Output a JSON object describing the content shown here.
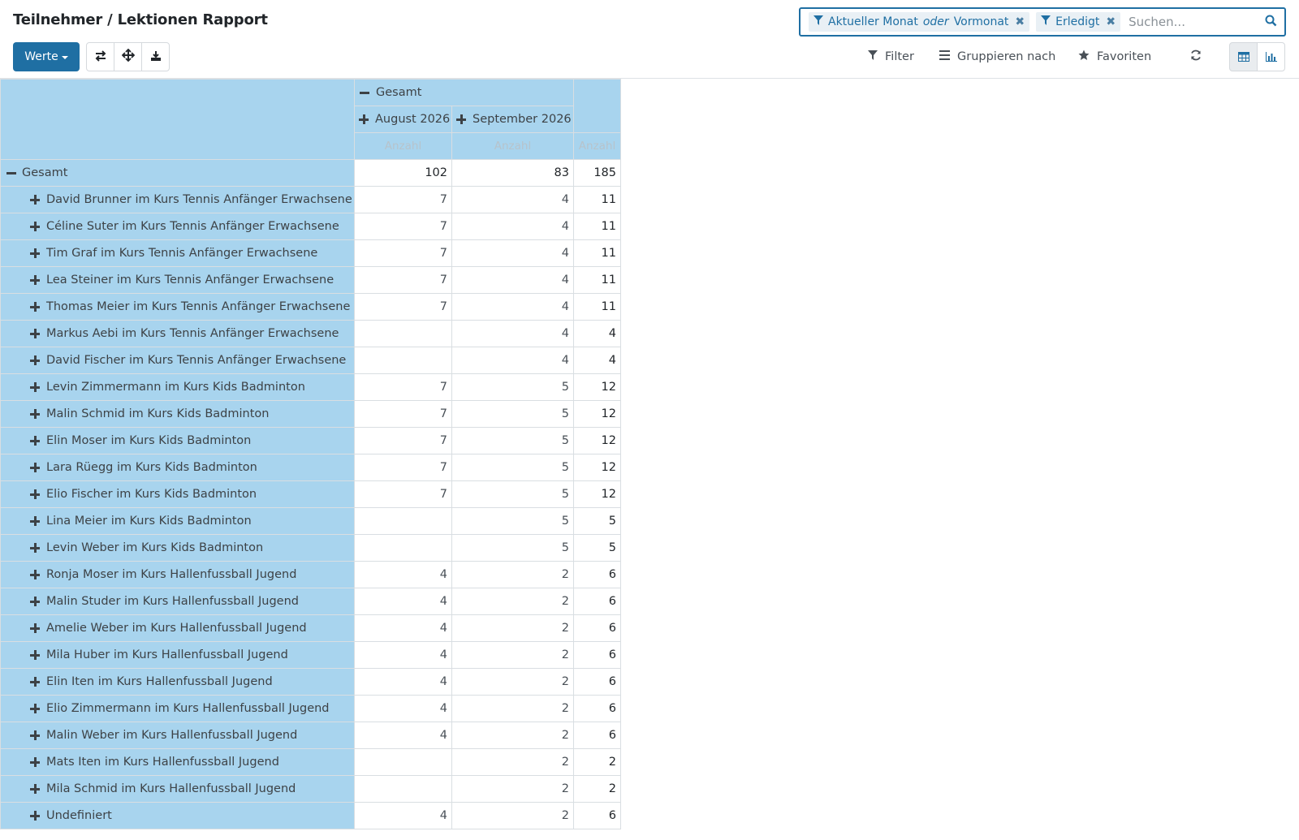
{
  "header": {
    "title": "Teilnehmer / Lektionen Rapport",
    "values_button": "Werte"
  },
  "search": {
    "facets": [
      {
        "part1": "Aktueller Monat",
        "or": "oder",
        "part2": "Vormonat"
      },
      {
        "label": "Erledigt"
      }
    ],
    "placeholder": "Suchen..."
  },
  "toolbar": {
    "filter": "Filter",
    "groupby": "Gruppieren nach",
    "favorites": "Favoriten"
  },
  "pivot": {
    "col_total_label": "Gesamt",
    "columns": [
      "August 2026",
      "September 2026"
    ],
    "measure": "Anzahl",
    "row_total_label": "Gesamt",
    "grand_totals": [
      "102",
      "83",
      "185"
    ],
    "rows": [
      {
        "label": "David Brunner im Kurs Tennis Anfänger Erwachsene",
        "aug": "7",
        "sep": "4",
        "total": "11"
      },
      {
        "label": "Céline Suter im Kurs Tennis Anfänger Erwachsene",
        "aug": "7",
        "sep": "4",
        "total": "11"
      },
      {
        "label": "Tim Graf im Kurs Tennis Anfänger Erwachsene",
        "aug": "7",
        "sep": "4",
        "total": "11"
      },
      {
        "label": "Lea Steiner im Kurs Tennis Anfänger Erwachsene",
        "aug": "7",
        "sep": "4",
        "total": "11"
      },
      {
        "label": "Thomas Meier im Kurs Tennis Anfänger Erwachsene",
        "aug": "7",
        "sep": "4",
        "total": "11"
      },
      {
        "label": "Markus Aebi im Kurs Tennis Anfänger Erwachsene",
        "aug": "",
        "sep": "4",
        "total": "4"
      },
      {
        "label": "David Fischer im Kurs Tennis Anfänger Erwachsene",
        "aug": "",
        "sep": "4",
        "total": "4"
      },
      {
        "label": "Levin Zimmermann im Kurs Kids Badminton",
        "aug": "7",
        "sep": "5",
        "total": "12"
      },
      {
        "label": "Malin Schmid im Kurs Kids Badminton",
        "aug": "7",
        "sep": "5",
        "total": "12"
      },
      {
        "label": "Elin Moser im Kurs Kids Badminton",
        "aug": "7",
        "sep": "5",
        "total": "12"
      },
      {
        "label": "Lara Rüegg im Kurs Kids Badminton",
        "aug": "7",
        "sep": "5",
        "total": "12"
      },
      {
        "label": "Elio Fischer im Kurs Kids Badminton",
        "aug": "7",
        "sep": "5",
        "total": "12"
      },
      {
        "label": "Lina Meier im Kurs Kids Badminton",
        "aug": "",
        "sep": "5",
        "total": "5"
      },
      {
        "label": "Levin Weber im Kurs Kids Badminton",
        "aug": "",
        "sep": "5",
        "total": "5"
      },
      {
        "label": "Ronja Moser im Kurs Hallenfussball Jugend",
        "aug": "4",
        "sep": "2",
        "total": "6"
      },
      {
        "label": "Malin Studer im Kurs Hallenfussball Jugend",
        "aug": "4",
        "sep": "2",
        "total": "6"
      },
      {
        "label": "Amelie Weber im Kurs Hallenfussball Jugend",
        "aug": "4",
        "sep": "2",
        "total": "6"
      },
      {
        "label": "Mila Huber im Kurs Hallenfussball Jugend",
        "aug": "4",
        "sep": "2",
        "total": "6"
      },
      {
        "label": "Elin Iten im Kurs Hallenfussball Jugend",
        "aug": "4",
        "sep": "2",
        "total": "6"
      },
      {
        "label": "Elio Zimmermann im Kurs Hallenfussball Jugend",
        "aug": "4",
        "sep": "2",
        "total": "6"
      },
      {
        "label": "Malin Weber im Kurs Hallenfussball Jugend",
        "aug": "4",
        "sep": "2",
        "total": "6"
      },
      {
        "label": "Mats Iten im Kurs Hallenfussball Jugend",
        "aug": "",
        "sep": "2",
        "total": "2"
      },
      {
        "label": "Mila Schmid im Kurs Hallenfussball Jugend",
        "aug": "",
        "sep": "2",
        "total": "2"
      },
      {
        "label": "Undefiniert",
        "aug": "4",
        "sep": "2",
        "total": "6"
      }
    ]
  }
}
